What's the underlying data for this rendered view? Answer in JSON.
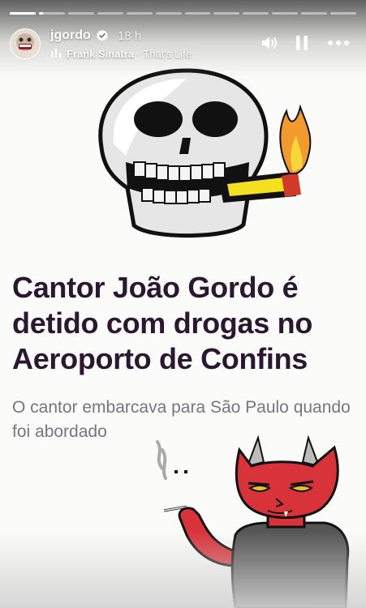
{
  "story": {
    "segments_total": 12,
    "active_segment_index": 1,
    "active_segment_progress": 0.15
  },
  "header": {
    "username": "jgordo",
    "verified": true,
    "time_ago": "18 h",
    "music": {
      "artist": "Frank Sinatra",
      "separator": " · ",
      "song": "That's Life"
    }
  },
  "controls": {
    "sound_icon": "speaker-icon",
    "pause_icon": "pause-icon",
    "more_icon": "more-options-icon"
  },
  "content": {
    "headline": "Cantor João Gordo é detido com drogas no Aeroporto de Confins",
    "subheadline": "O cantor embarcava para São Paulo quando foi abordado"
  },
  "colors": {
    "headline": "#2c1730",
    "subheadline": "#787480",
    "background": "#fbfbf9",
    "devil_red": "#d8323a"
  }
}
